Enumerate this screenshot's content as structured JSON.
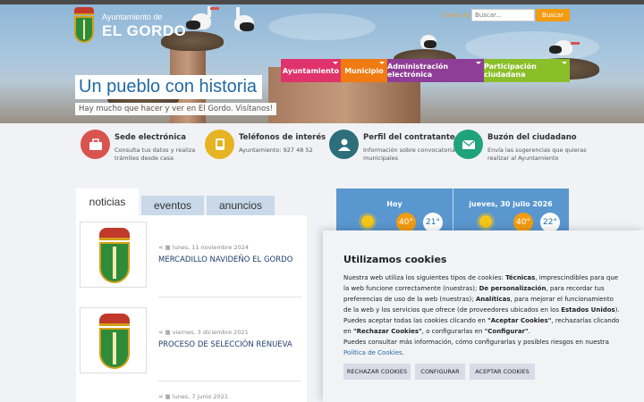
{
  "header": {
    "logo_small": "Ayuntamiento de",
    "logo_big": "EL GORDO",
    "contact_label": "Contacto",
    "search_placeholder": "Buscar...",
    "search_button": "Buscar"
  },
  "nav": [
    {
      "label": "Ayuntamiento",
      "color": "#e0336c"
    },
    {
      "label": "Municipio",
      "color": "#f07b12"
    },
    {
      "label": "Administración electrónica",
      "color": "#8e3e96"
    },
    {
      "label": "Participación ciudadana",
      "color": "#8bbf2a"
    }
  ],
  "hero": {
    "slogan": "Un pueblo con historia",
    "subtitle": "Hay mucho que hacer y ver en El Gordo. Visítanos!"
  },
  "services": [
    {
      "title": "Sede electrónica",
      "desc": "Consulta tus datos y realiza trámites desde casa",
      "color": "#d9534f",
      "icon": "briefcase-icon"
    },
    {
      "title": "Teléfonos de interés",
      "desc": "Ayuntamiento: 927 48 52",
      "color": "#e6b422",
      "icon": "phone-icon"
    },
    {
      "title": "Perfil del contratante",
      "desc": "Información sobre convocatorias municipales",
      "color": "#2c6e7a",
      "icon": "person-icon"
    },
    {
      "title": "Buzón del ciudadano",
      "desc": "Envía las sugerencias que quieras realizar al Ayuntamiento",
      "color": "#1fa37a",
      "icon": "envelope-icon"
    }
  ],
  "tabs": [
    "noticias",
    "eventos",
    "anuncios"
  ],
  "news": [
    {
      "date": "lunes, 11 noviembre 2024",
      "title": "MERCADILLO NAVIDEÑO EL GORDO"
    },
    {
      "date": "viernes, 3 diciembre 2021",
      "title": "PROCESO DE SELECCIÓN RENUEVA"
    },
    {
      "date": "lunes, 7 junio 2021",
      "title": ""
    }
  ],
  "weather": {
    "today": {
      "label": "Hoy",
      "max": "40°",
      "min": "21°"
    },
    "tomorrow": {
      "label": "jueves, 30 julio 2026",
      "max": "40°",
      "min": "22°"
    }
  },
  "cookie": {
    "title": "Utilizamos cookies",
    "p1_a": "Nuestra web utiliza los siguientes tipos de cookies: ",
    "p1_b": "Técnicas",
    "p1_c": ", imprescindibles para que la web funcione correctamente (nuestras); ",
    "p1_d": "De personalización",
    "p1_e": ", para recordar tus preferencias de uso de la web (nuestras); ",
    "p1_f": "Analíticas",
    "p1_g": ", para mejorar el funcionamiento de la web y los servicios que ofrece (de proveedores ubicados en los ",
    "p1_h": "Estados Unidos",
    "p1_i": ").",
    "p2_a": "Puedes aceptar todas las cookies clicando en ",
    "p2_b": "\"Aceptar Cookies\"",
    "p2_c": ", rechazarlas clicando en ",
    "p2_d": "\"Rechazar Cookies\"",
    "p2_e": ", o configurarlas en ",
    "p2_f": "\"Configurar\"",
    "p2_g": ".",
    "p3": "Puedes consultar más información, cómo configurarlas y posibles riesgos en nuestra",
    "policy_link": "Política de Cookies",
    "policy_end": ".",
    "btn_reject": "RECHAZAR COOKIES",
    "btn_config": "CONFIGURAR",
    "btn_accept": "ACEPTAR COOKIES"
  }
}
